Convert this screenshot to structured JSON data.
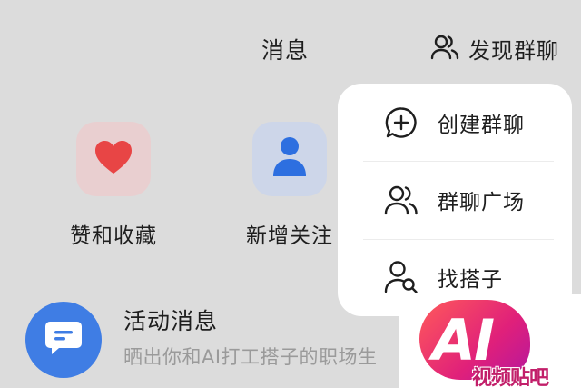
{
  "header": {
    "title": "消息",
    "discover_label": "发现群聊"
  },
  "entries": [
    {
      "label": "赞和收藏",
      "icon": "heart-icon",
      "color": "#e84545"
    },
    {
      "label": "新增关注",
      "icon": "person-icon",
      "color": "#2d6fe0"
    }
  ],
  "activity": {
    "title": "活动消息",
    "subtitle": "晒出你和AI打工搭子的职场生",
    "icon": "message-icon",
    "color": "#3f7de4"
  },
  "menu": {
    "items": [
      {
        "label": "创建群聊",
        "icon": "add-chat-icon"
      },
      {
        "label": "群聊广场",
        "icon": "group-icon"
      },
      {
        "label": "找搭子",
        "icon": "find-person-icon"
      }
    ]
  },
  "watermark": {
    "big": "AI",
    "small": "视频贴吧"
  }
}
